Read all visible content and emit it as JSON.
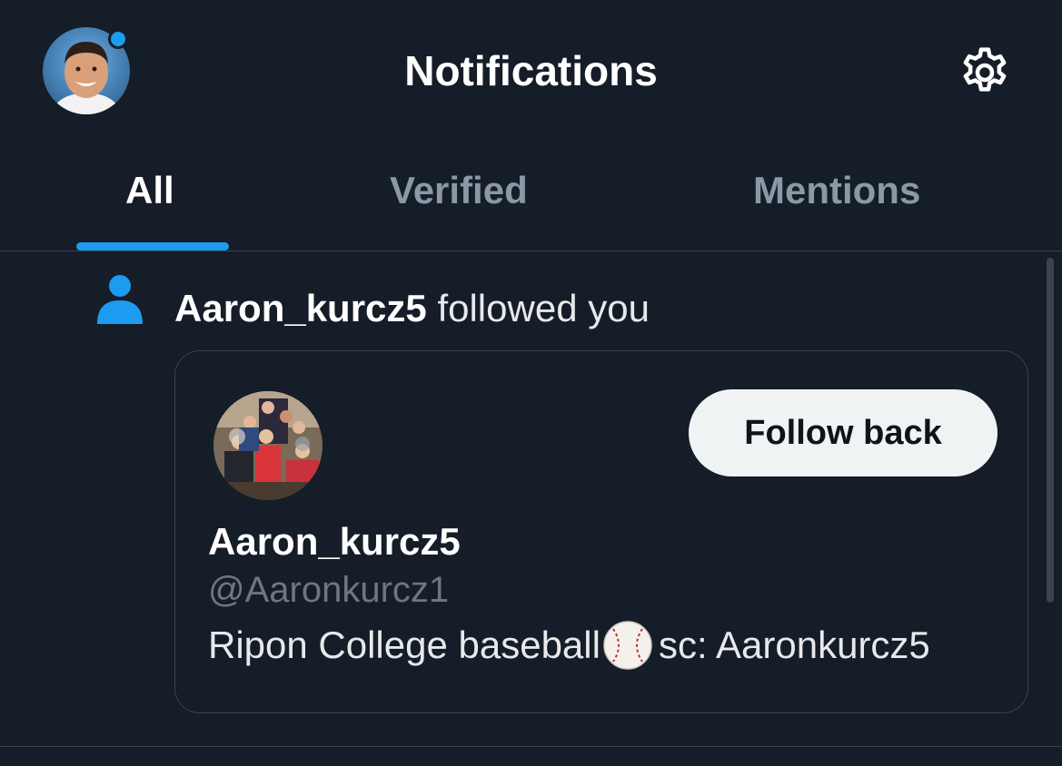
{
  "header": {
    "title": "Notifications",
    "avatar_icon": "user-avatar",
    "settings_icon": "gear-icon"
  },
  "tabs": [
    {
      "label": "All",
      "active": true
    },
    {
      "label": "Verified",
      "active": false
    },
    {
      "label": "Mentions",
      "active": false
    }
  ],
  "notification": {
    "icon": "person-icon",
    "username": "Aaron_kurcz5",
    "action_text": "followed you",
    "card": {
      "display_name": "Aaron_kurcz5",
      "handle": "@Aaronkurcz1",
      "bio_before": "Ripon College baseball",
      "bio_emoji": "baseball-emoji",
      "bio_after": "sc: Aaronkurcz5",
      "follow_label": "Follow back"
    }
  },
  "colors": {
    "background": "#151d28",
    "accent": "#1d9bf0",
    "text_primary": "#ffffff",
    "text_secondary": "#8b98a5",
    "divider": "#38444d",
    "button_bg": "#eff3f4"
  }
}
